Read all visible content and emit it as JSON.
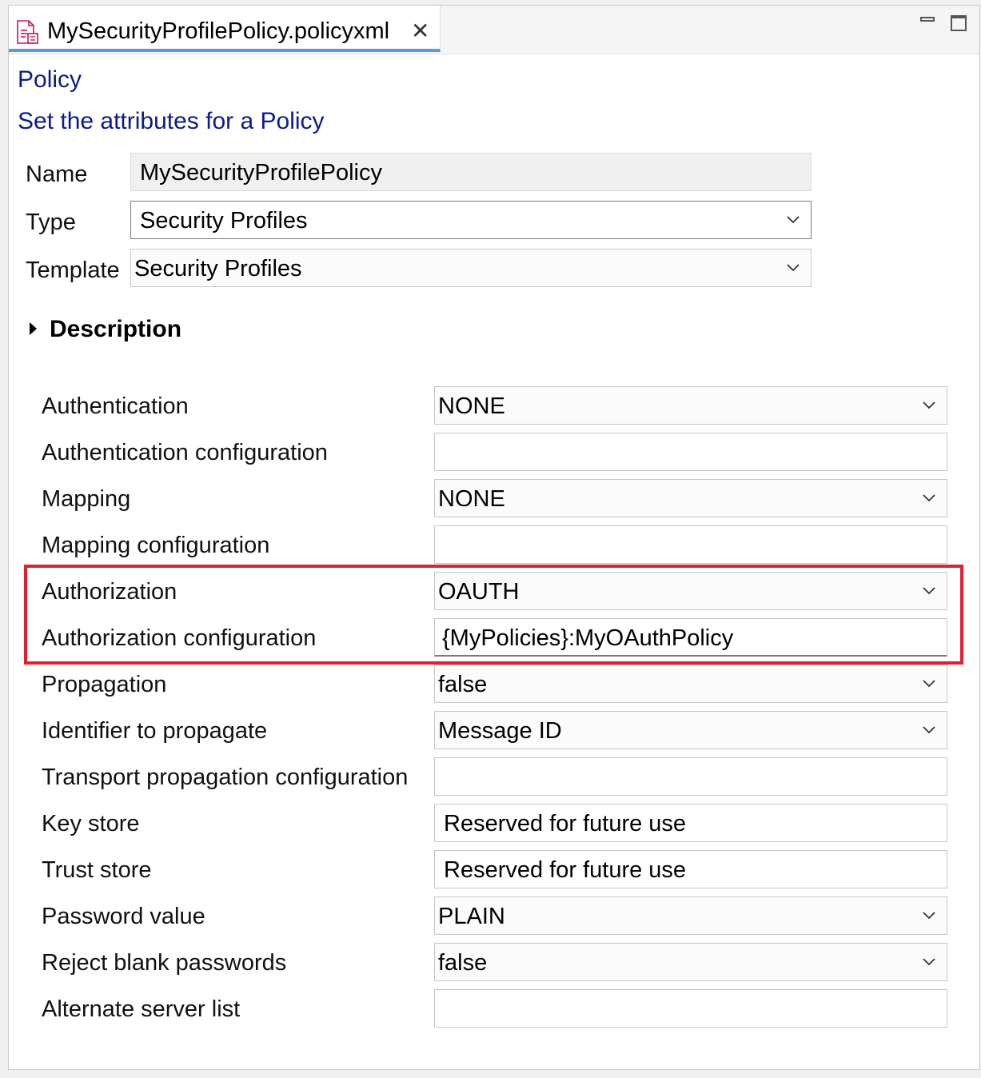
{
  "tab": {
    "title": "MySecurityProfilePolicy.policyxml",
    "icon": "policy-file-icon",
    "close_glyph": "✕"
  },
  "window_controls": {
    "minimize": "minimize-icon",
    "maximize": "maximize-icon"
  },
  "header": {
    "title": "Policy",
    "subtitle": "Set the attributes for a Policy"
  },
  "general": {
    "name_label": "Name",
    "name_value": "MySecurityProfilePolicy",
    "type_label": "Type",
    "type_value": "Security Profiles",
    "template_label": "Template",
    "template_value": "Security Profiles"
  },
  "description": {
    "label": "Description",
    "expanded": false
  },
  "properties": {
    "authentication": {
      "label": "Authentication",
      "value": "NONE"
    },
    "authentication_config": {
      "label": "Authentication configuration",
      "value": ""
    },
    "mapping": {
      "label": "Mapping",
      "value": "NONE"
    },
    "mapping_config": {
      "label": "Mapping configuration",
      "value": ""
    },
    "authorization": {
      "label": "Authorization",
      "value": "OAUTH"
    },
    "authorization_config": {
      "label": "Authorization configuration",
      "value": "{MyPolicies}:MyOAuthPolicy"
    },
    "propagation": {
      "label": "Propagation",
      "value": "false"
    },
    "identifier": {
      "label": "Identifier to propagate",
      "value": "Message ID"
    },
    "transport_config": {
      "label": "Transport propagation configuration",
      "value": ""
    },
    "key_store": {
      "label": "Key store",
      "value": "Reserved for future use"
    },
    "trust_store": {
      "label": "Trust store",
      "value": "Reserved for future use"
    },
    "password_value": {
      "label": "Password value",
      "value": "PLAIN"
    },
    "reject_blank": {
      "label": "Reject blank passwords",
      "value": "false"
    },
    "alternate_servers": {
      "label": "Alternate server list",
      "value": ""
    }
  },
  "colors": {
    "heading": "#0b1c8a",
    "highlight": "#e0202e",
    "tab_accent": "#5b9bd5"
  }
}
